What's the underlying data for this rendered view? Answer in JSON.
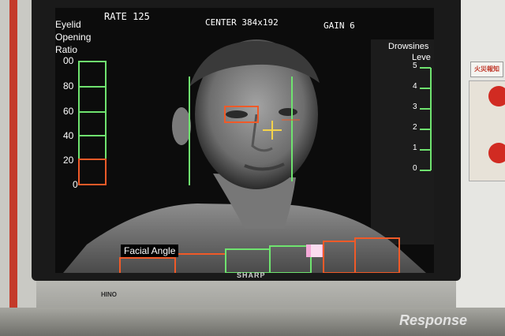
{
  "hud": {
    "rate_label": "RATE 125",
    "center_label": "CENTER 384x192",
    "gain_label": "GAIN 6"
  },
  "eyelid_gauge": {
    "title_lines": [
      "Eyelid",
      "Opening",
      "Ratio"
    ],
    "ticks": [
      "00",
      "80",
      "60",
      "40",
      "20",
      "0"
    ],
    "level_percent": 20
  },
  "drowsiness_gauge": {
    "title_lines": [
      "Drowsines",
      "Leve"
    ],
    "ticks": [
      "5",
      "4",
      "3",
      "2",
      "1",
      "0"
    ],
    "level": 0
  },
  "facial_angle": {
    "label": "Facial Angle"
  },
  "monitor": {
    "brand": "SHARP",
    "logo_left": "HINO"
  },
  "environment": {
    "sign_text": "火災報知",
    "watermark": "Response"
  },
  "colors": {
    "green": "#6fe36f",
    "orange": "#f05a28",
    "cross": "#f3d24a",
    "pink": "#f4a9d8"
  }
}
